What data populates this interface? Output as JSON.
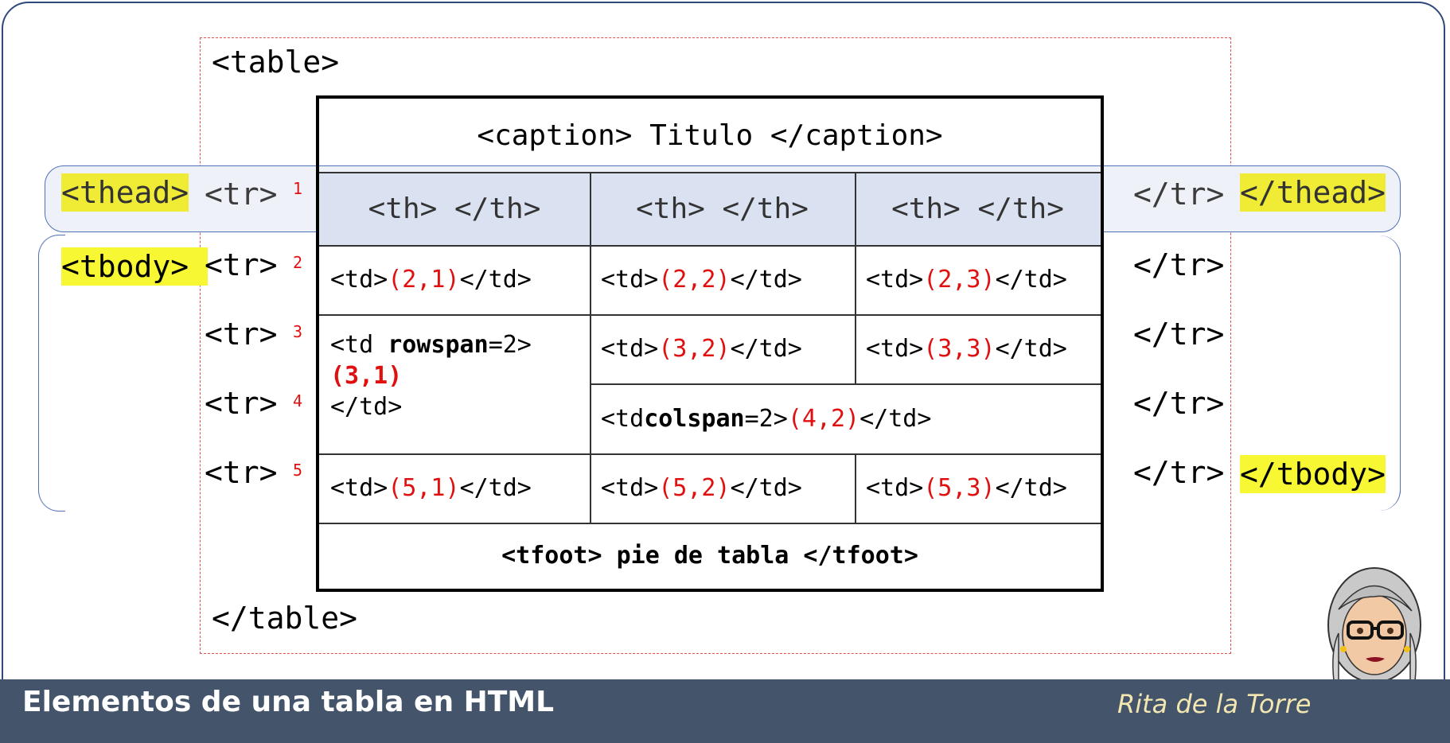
{
  "table_open": "<table>",
  "table_close": "</table>",
  "caption": "<caption> Titulo </caption>",
  "thead_open": "<thead>",
  "thead_close": "</thead>",
  "tbody_open": "<tbody>",
  "tbody_close": "</tbody>",
  "tr_open": "<tr>",
  "tr_close": "</tr>",
  "row_numbers": [
    "1",
    "2",
    "3",
    "4",
    "5"
  ],
  "th_text": "<th> </th>",
  "cells": {
    "td_open": "<td>",
    "td_close": "</td>",
    "c21": "(2,1)",
    "c22": "(2,2)",
    "c23": "(2,3)",
    "rowspan_open": "<td ",
    "rowspan_attr": "rowspan",
    "rowspan_val": "=2>",
    "c31": "(3,1)",
    "c32": "(3,2)",
    "c33": "(3,3)",
    "colspan_attr": "colspan",
    "colspan_val": "=2>",
    "c42": "(4,2)",
    "c51": "(5,1)",
    "c52": "(5,2)",
    "c53": "(5,3)"
  },
  "tfoot": "<tfoot> pie de tabla </tfoot>",
  "footer": {
    "title": "Elementos de una tabla en HTML",
    "author": "Rita de la Torre"
  },
  "colors": {
    "footer_bg": "#44546a",
    "header_bg": "#dae1f1",
    "highlight": "#f7f733",
    "accent_red": "#e01010",
    "frame_border": "#2f4a7a"
  }
}
